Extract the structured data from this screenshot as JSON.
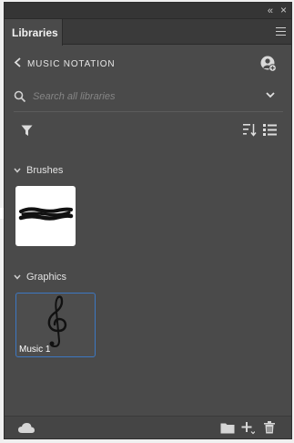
{
  "panel": {
    "collapse_glyph": "«",
    "close_glyph": "×",
    "tab_label": "Libraries",
    "menu_icon": "hamburger-icon"
  },
  "library": {
    "back_icon": "chevron-left-icon",
    "name": "MUSIC NOTATION",
    "add_user_icon": "add-user-icon"
  },
  "search": {
    "placeholder": "Search all libraries",
    "value": "",
    "dropdown_icon": "chevron-down-icon"
  },
  "toolbar": {
    "filter_icon": "filter-icon",
    "sort_icon": "sort-icon",
    "view_icon": "list-view-icon"
  },
  "sections": [
    {
      "title": "Brushes",
      "items": [
        {
          "label": "",
          "thumb": "brush-stroke"
        }
      ]
    },
    {
      "title": "Graphics",
      "items": [
        {
          "label": "Music 1",
          "thumb": "treble-clef"
        }
      ]
    }
  ],
  "footer": {
    "cloud_icon": "cloud-icon",
    "folder_icon": "folder-icon",
    "add_icon": "add-icon",
    "delete_icon": "trash-icon"
  },
  "colors": {
    "panel_bg": "#4a4a4a",
    "selection": "#3d78c2"
  }
}
